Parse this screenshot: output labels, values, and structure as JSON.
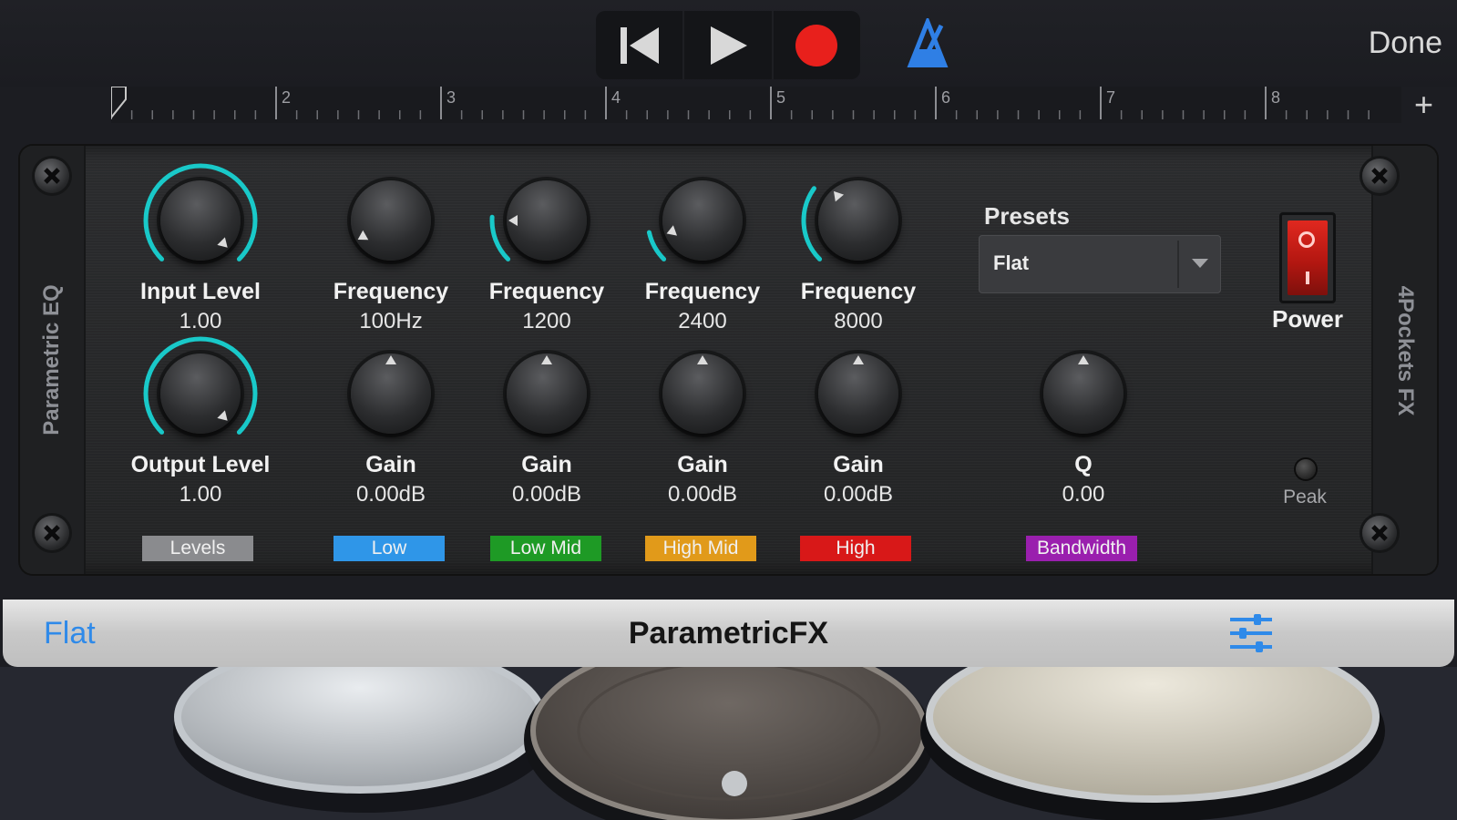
{
  "transport": {
    "rewind_icon": "skip-back-icon",
    "play_icon": "play-icon",
    "record_icon": "record-icon",
    "metronome_icon": "metronome-icon",
    "done_label": "Done",
    "record_color": "#e8201c",
    "metronome_color": "#2f7fe5"
  },
  "ruler": {
    "bar_numbers": [
      "2",
      "3",
      "4",
      "5",
      "6",
      "7",
      "8"
    ],
    "add_label": "+"
  },
  "plugin": {
    "left_side_label": "Parametric EQ",
    "right_side_label": "4Pockets FX",
    "knobs": {
      "input_level": {
        "label": "Input Level",
        "value": "1.00"
      },
      "output_level": {
        "label": "Output Level",
        "value": "1.00"
      },
      "freq_low": {
        "label": "Frequency",
        "value": "100Hz"
      },
      "freq_low_mid": {
        "label": "Frequency",
        "value": "1200"
      },
      "freq_high_mid": {
        "label": "Frequency",
        "value": "2400"
      },
      "freq_high": {
        "label": "Frequency",
        "value": "8000"
      },
      "gain_low": {
        "label": "Gain",
        "value": "0.00dB"
      },
      "gain_low_mid": {
        "label": "Gain",
        "value": "0.00dB"
      },
      "gain_high_mid": {
        "label": "Gain",
        "value": "0.00dB"
      },
      "gain_high": {
        "label": "Gain",
        "value": "0.00dB"
      },
      "q": {
        "label": "Q",
        "value": "0.00"
      }
    },
    "bands": {
      "levels": {
        "label": "Levels",
        "color": "#8a8b8e"
      },
      "low": {
        "label": "Low",
        "color": "#2f96e8"
      },
      "low_mid": {
        "label": "Low Mid",
        "color": "#1e9a25"
      },
      "high_mid": {
        "label": "High Mid",
        "color": "#e19a1a"
      },
      "high": {
        "label": "High",
        "color": "#d81818"
      },
      "bandwidth": {
        "label": "Bandwidth",
        "color": "#9a1fae"
      }
    },
    "presets_label": "Presets",
    "preset_value": "Flat",
    "power_label": "Power",
    "peak_label": "Peak",
    "arc_color": "#19c9c9"
  },
  "bottom_bar": {
    "preset_name": "Flat",
    "title": "ParametricFX",
    "settings_icon": "sliders-icon"
  }
}
